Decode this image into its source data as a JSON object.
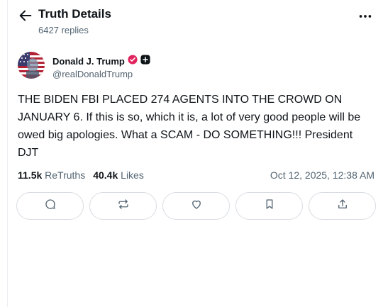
{
  "header": {
    "title": "Truth Details",
    "replies": "6427 replies",
    "back_icon": "arrow-left-icon",
    "more_icon": "more-horizontal-icon"
  },
  "author": {
    "name": "Donald J. Trump",
    "handle": "@realDonaldTrump",
    "verified_color": "#e0245e"
  },
  "post": {
    "text": "THE BIDEN FBI PLACED 274 AGENTS INTO THE CROWD ON JANUARY 6. If this is so, which it is, a lot of very good people will be owed big apologies. What a SCAM - DO SOMETHING!!! President DJT"
  },
  "stats": {
    "retruths_count": "11.5k",
    "retruths_label": "ReTruths",
    "likes_count": "40.4k",
    "likes_label": "Likes",
    "timestamp": "Oct 12, 2025, 12:38 AM"
  },
  "actions": [
    "reply-icon",
    "retruth-icon",
    "like-icon",
    "bookmark-icon",
    "share-icon"
  ]
}
